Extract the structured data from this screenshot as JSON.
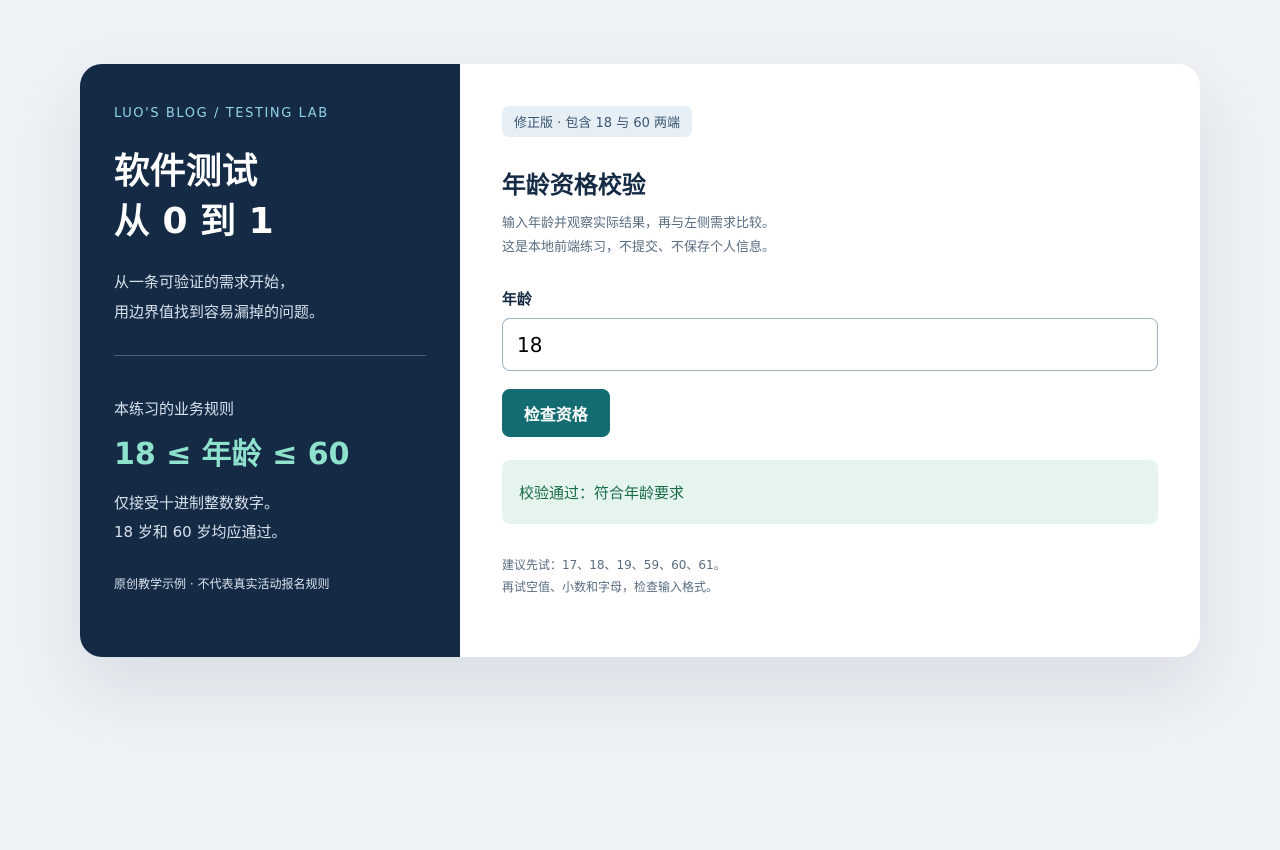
{
  "left_panel": {
    "brand": "LUO'S BLOG / TESTING LAB",
    "hero_title_line1": "软件测试",
    "hero_title_line2": "从 0 到 1",
    "hero_desc_line1": "从一条可验证的需求开始，",
    "hero_desc_line2": "用边界值找到容易漏掉的问题。",
    "rule_heading": "本练习的业务规则",
    "rule_formula": "18 ≤ 年龄 ≤ 60",
    "rule_desc_line1": "仅接受十进制整数数字。",
    "rule_desc_line2": "18 岁和 60 岁均应通过。",
    "rule_note": "原创教学示例 · 不代表真实活动报名规则"
  },
  "form": {
    "badge": "修正版 · 包含 18 与 60 两端",
    "title": "年龄资格校验",
    "desc_line1": "输入年龄并观察实际结果，再与左侧需求比较。",
    "desc_line2": "这是本地前端练习，不提交、不保存个人信息。",
    "age_label": "年龄",
    "age_value": "18",
    "check_button": "检查资格",
    "result": "校验通过：符合年龄要求",
    "hint_line1": "建议先试：17、18、19、59、60、61。",
    "hint_line2": "再试空值、小数和字母，检查输入格式。"
  },
  "colors": {
    "panel_bg": "#152a45",
    "accent": "#126c71",
    "formula": "#8ee2cc",
    "success_bg": "#e5f5ee",
    "success_text": "#1b6b48"
  }
}
